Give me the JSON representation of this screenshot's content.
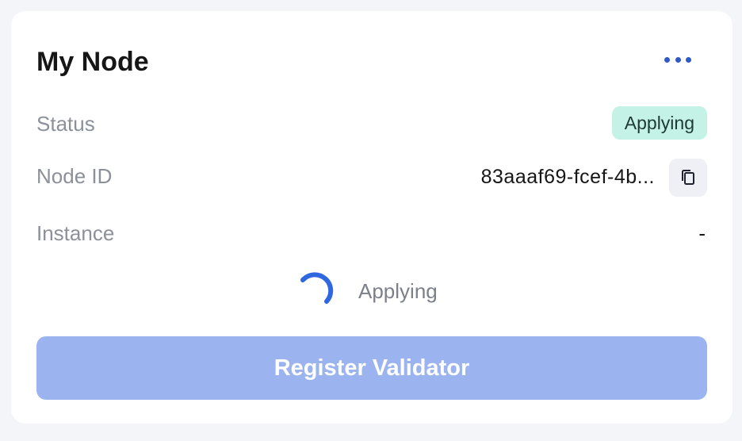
{
  "card": {
    "title": "My Node"
  },
  "rows": {
    "status": {
      "label": "Status",
      "value": "Applying"
    },
    "node_id": {
      "label": "Node ID",
      "value": "83aaaf69-fcef-4b..."
    },
    "instance": {
      "label": "Instance",
      "value": "-"
    }
  },
  "loading": {
    "text": "Applying"
  },
  "actions": {
    "register_label": "Register Validator"
  },
  "icons": {
    "more": "more-horizontal-icon",
    "copy": "copy-icon",
    "spinner": "loading-spinner-icon"
  },
  "colors": {
    "accent": "#2f59c7",
    "status_badge_bg": "#c5f2e6",
    "register_button_bg": "#9bb4f0"
  }
}
